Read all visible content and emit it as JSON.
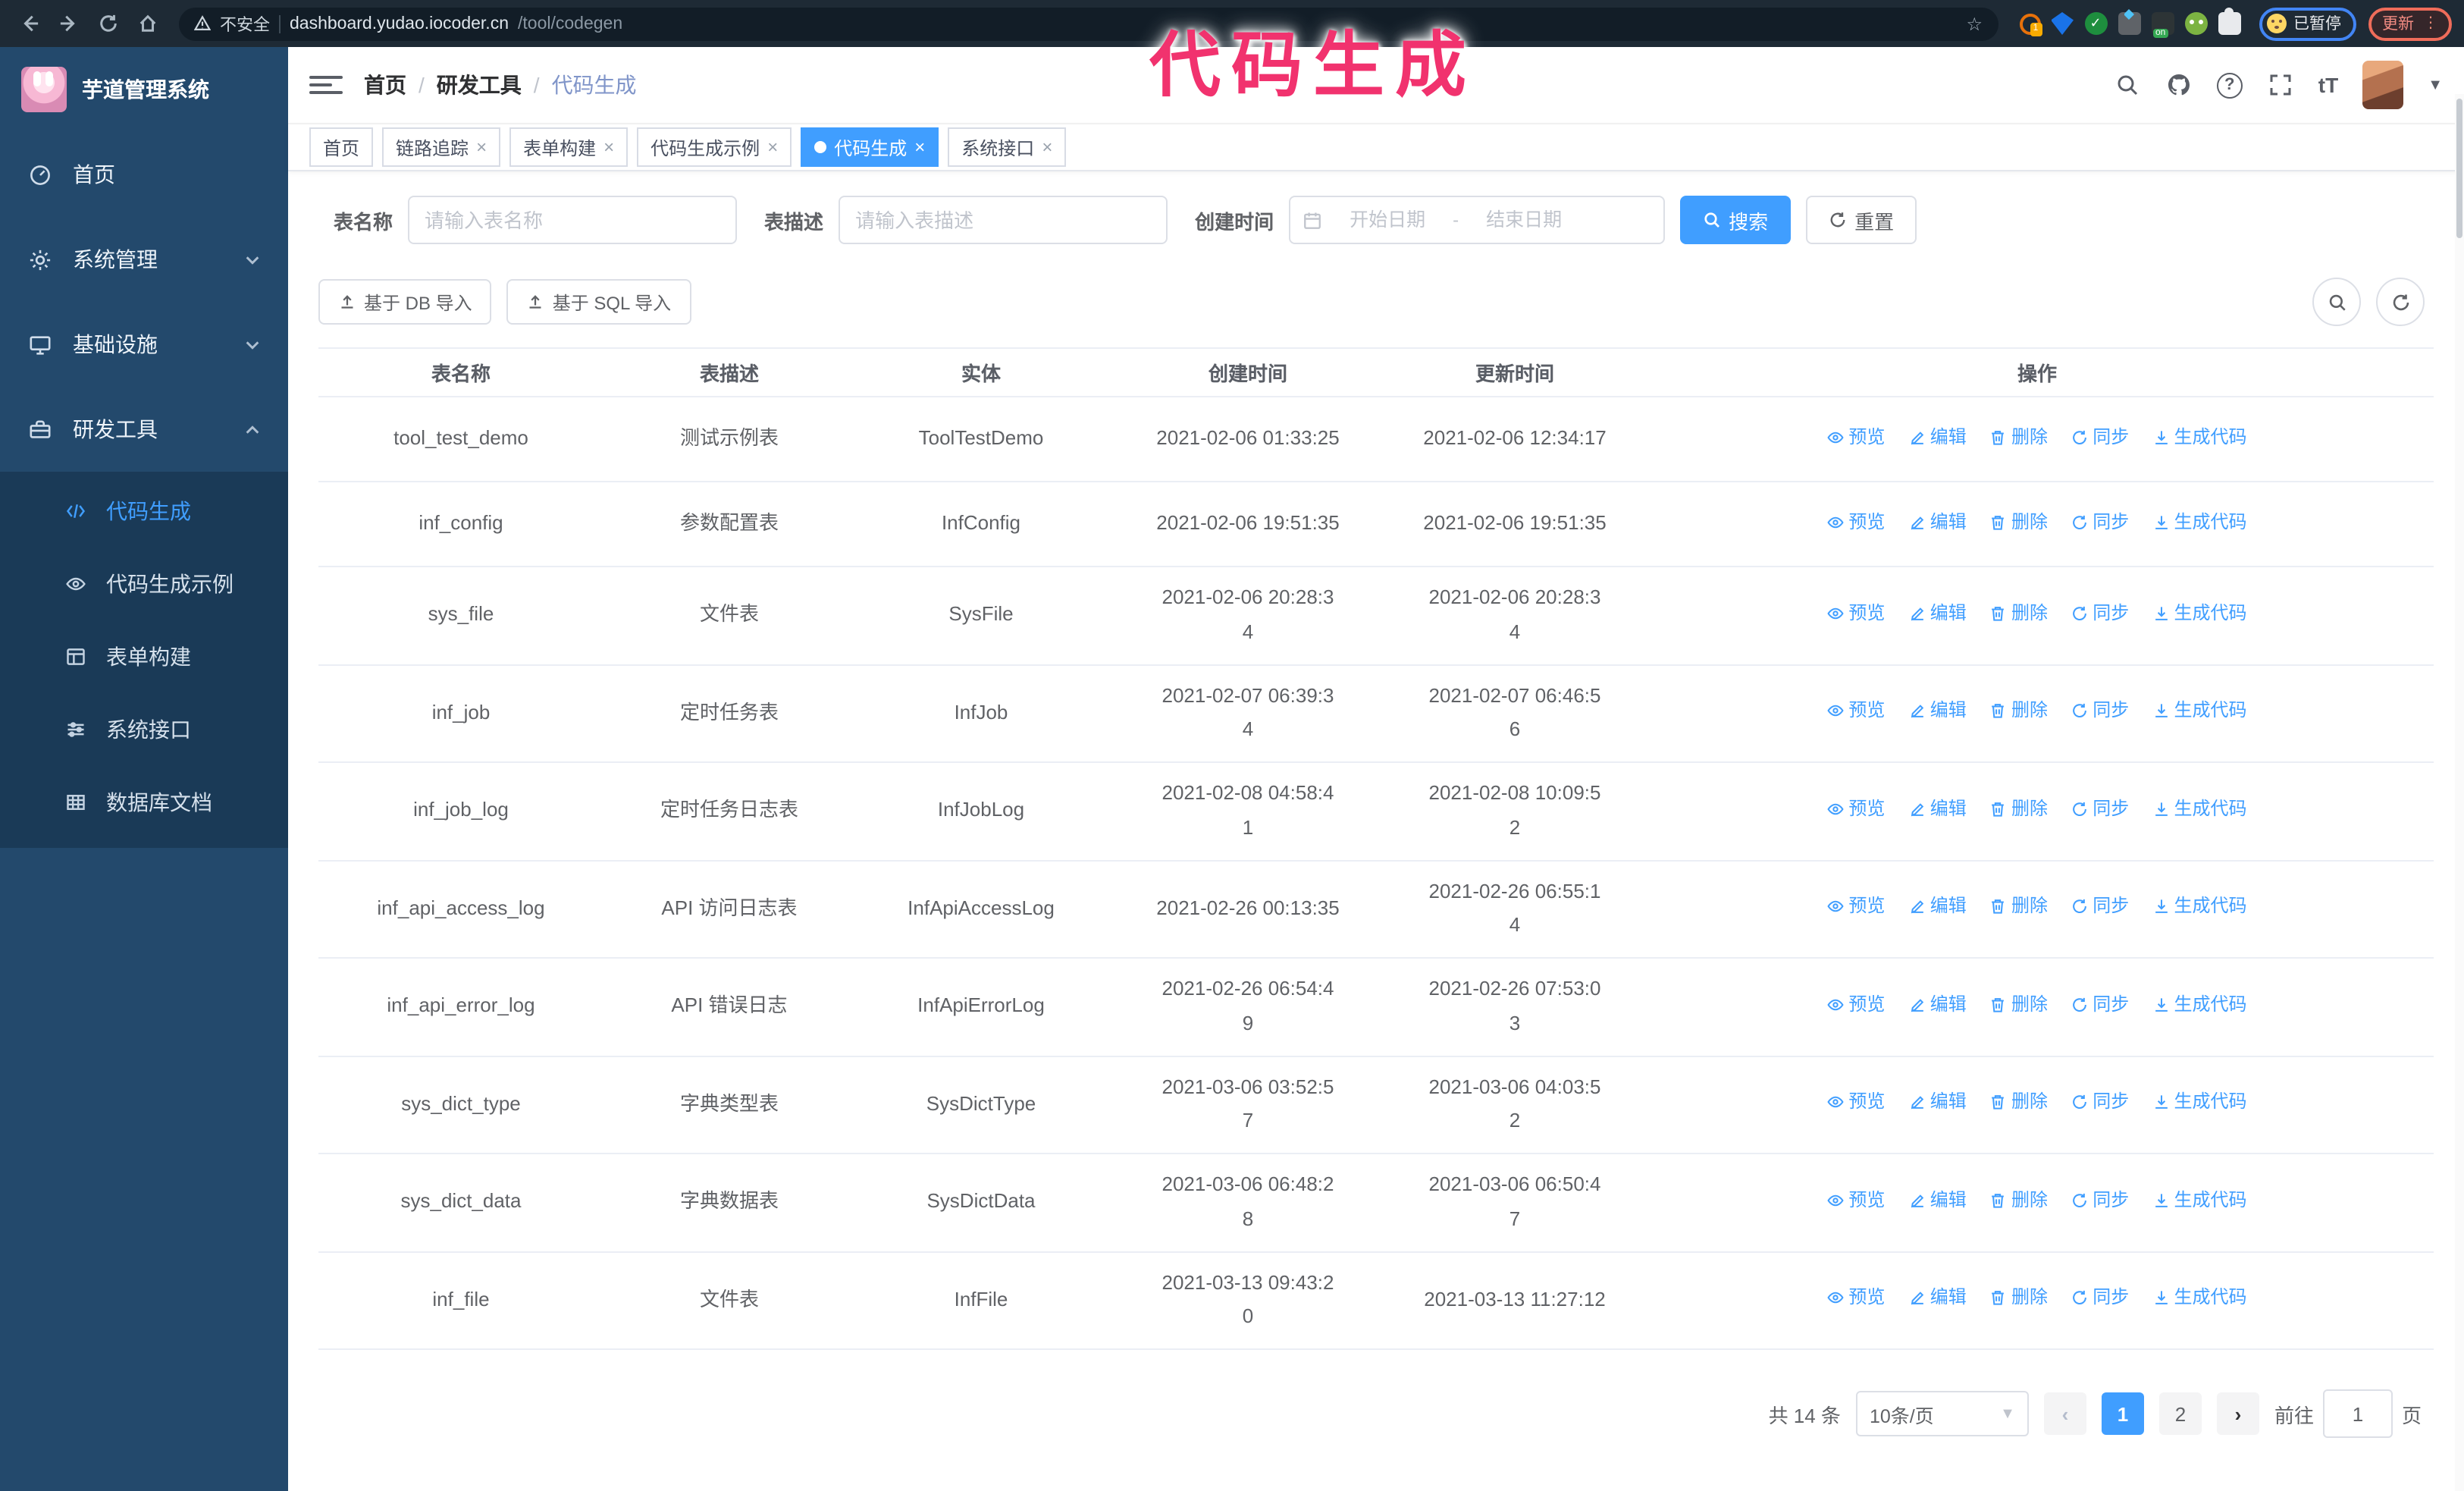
{
  "colors": {
    "accent": "#409eff",
    "sidebar_bg": "#23496c",
    "submenu_bg": "#1a3a57",
    "watermark_pink": "#f1326e"
  },
  "overlay": {
    "watermark": "代码生成"
  },
  "browser": {
    "security_label": "不安全",
    "url_host": "dashboard.yudao.iocoder.cn",
    "url_path": "/tool/codegen",
    "paused_badge": "已暂停",
    "update_button": "更新",
    "extension_badge": "1"
  },
  "sidebar": {
    "logo_title": "芋道管理系统",
    "items": [
      {
        "label": "首页"
      },
      {
        "label": "系统管理"
      },
      {
        "label": "基础设施"
      },
      {
        "label": "研发工具"
      }
    ],
    "subitems": [
      {
        "label": "代码生成",
        "active": true
      },
      {
        "label": "代码生成示例"
      },
      {
        "label": "表单构建"
      },
      {
        "label": "系统接口"
      },
      {
        "label": "数据库文档"
      }
    ]
  },
  "breadcrumb": {
    "items": [
      "首页",
      "研发工具",
      "代码生成"
    ]
  },
  "tabs": [
    {
      "label": "首页",
      "closable": false,
      "active": false
    },
    {
      "label": "链路追踪",
      "closable": true,
      "active": false
    },
    {
      "label": "表单构建",
      "closable": true,
      "active": false
    },
    {
      "label": "代码生成示例",
      "closable": true,
      "active": false
    },
    {
      "label": "代码生成",
      "closable": true,
      "active": true
    },
    {
      "label": "系统接口",
      "closable": true,
      "active": false
    }
  ],
  "filters": {
    "name_label": "表名称",
    "name_placeholder": "请输入表名称",
    "desc_label": "表描述",
    "desc_placeholder": "请输入表描述",
    "time_label": "创建时间",
    "start_placeholder": "开始日期",
    "range_separator": "-",
    "end_placeholder": "结束日期",
    "search_label": "搜索",
    "reset_label": "重置"
  },
  "toolbar": {
    "db_import": "基于 DB 导入",
    "sql_import": "基于 SQL 导入"
  },
  "table": {
    "headers": [
      "表名称",
      "表描述",
      "实体",
      "创建时间",
      "更新时间",
      "操作"
    ],
    "actions": [
      "预览",
      "编辑",
      "删除",
      "同步",
      "生成代码"
    ],
    "rows": [
      {
        "name": "tool_test_demo",
        "desc": "测试示例表",
        "entity": "ToolTestDemo",
        "created": [
          "2021-02-06 01:33:25"
        ],
        "updated": [
          "2021-02-06 12:34:17"
        ]
      },
      {
        "name": "inf_config",
        "desc": "参数配置表",
        "entity": "InfConfig",
        "created": [
          "2021-02-06 19:51:35"
        ],
        "updated": [
          "2021-02-06 19:51:35"
        ]
      },
      {
        "name": "sys_file",
        "desc": "文件表",
        "entity": "SysFile",
        "created": [
          "2021-02-06 20:28:3",
          "4"
        ],
        "updated": [
          "2021-02-06 20:28:3",
          "4"
        ]
      },
      {
        "name": "inf_job",
        "desc": "定时任务表",
        "entity": "InfJob",
        "created": [
          "2021-02-07 06:39:3",
          "4"
        ],
        "updated": [
          "2021-02-07 06:46:5",
          "6"
        ]
      },
      {
        "name": "inf_job_log",
        "desc": "定时任务日志表",
        "entity": "InfJobLog",
        "created": [
          "2021-02-08 04:58:4",
          "1"
        ],
        "updated": [
          "2021-02-08 10:09:5",
          "2"
        ]
      },
      {
        "name": "inf_api_access_log",
        "desc": "API 访问日志表",
        "entity": "InfApiAccessLog",
        "created": [
          "2021-02-26 00:13:35"
        ],
        "updated": [
          "2021-02-26 06:55:1",
          "4"
        ]
      },
      {
        "name": "inf_api_error_log",
        "desc": "API 错误日志",
        "entity": "InfApiErrorLog",
        "created": [
          "2021-02-26 06:54:4",
          "9"
        ],
        "updated": [
          "2021-02-26 07:53:0",
          "3"
        ]
      },
      {
        "name": "sys_dict_type",
        "desc": "字典类型表",
        "entity": "SysDictType",
        "created": [
          "2021-03-06 03:52:5",
          "7"
        ],
        "updated": [
          "2021-03-06 04:03:5",
          "2"
        ]
      },
      {
        "name": "sys_dict_data",
        "desc": "字典数据表",
        "entity": "SysDictData",
        "created": [
          "2021-03-06 06:48:2",
          "8"
        ],
        "updated": [
          "2021-03-06 06:50:4",
          "7"
        ]
      },
      {
        "name": "inf_file",
        "desc": "文件表",
        "entity": "InfFile",
        "created": [
          "2021-03-13 09:43:2",
          "0"
        ],
        "updated": [
          "2021-03-13 11:27:12"
        ]
      }
    ]
  },
  "pagination": {
    "total": "共 14 条",
    "page_size": "10条/页",
    "pages": [
      "1",
      "2"
    ],
    "active_page": "1",
    "goto_label": "前往",
    "goto_value": "1",
    "page_suffix": "页"
  }
}
